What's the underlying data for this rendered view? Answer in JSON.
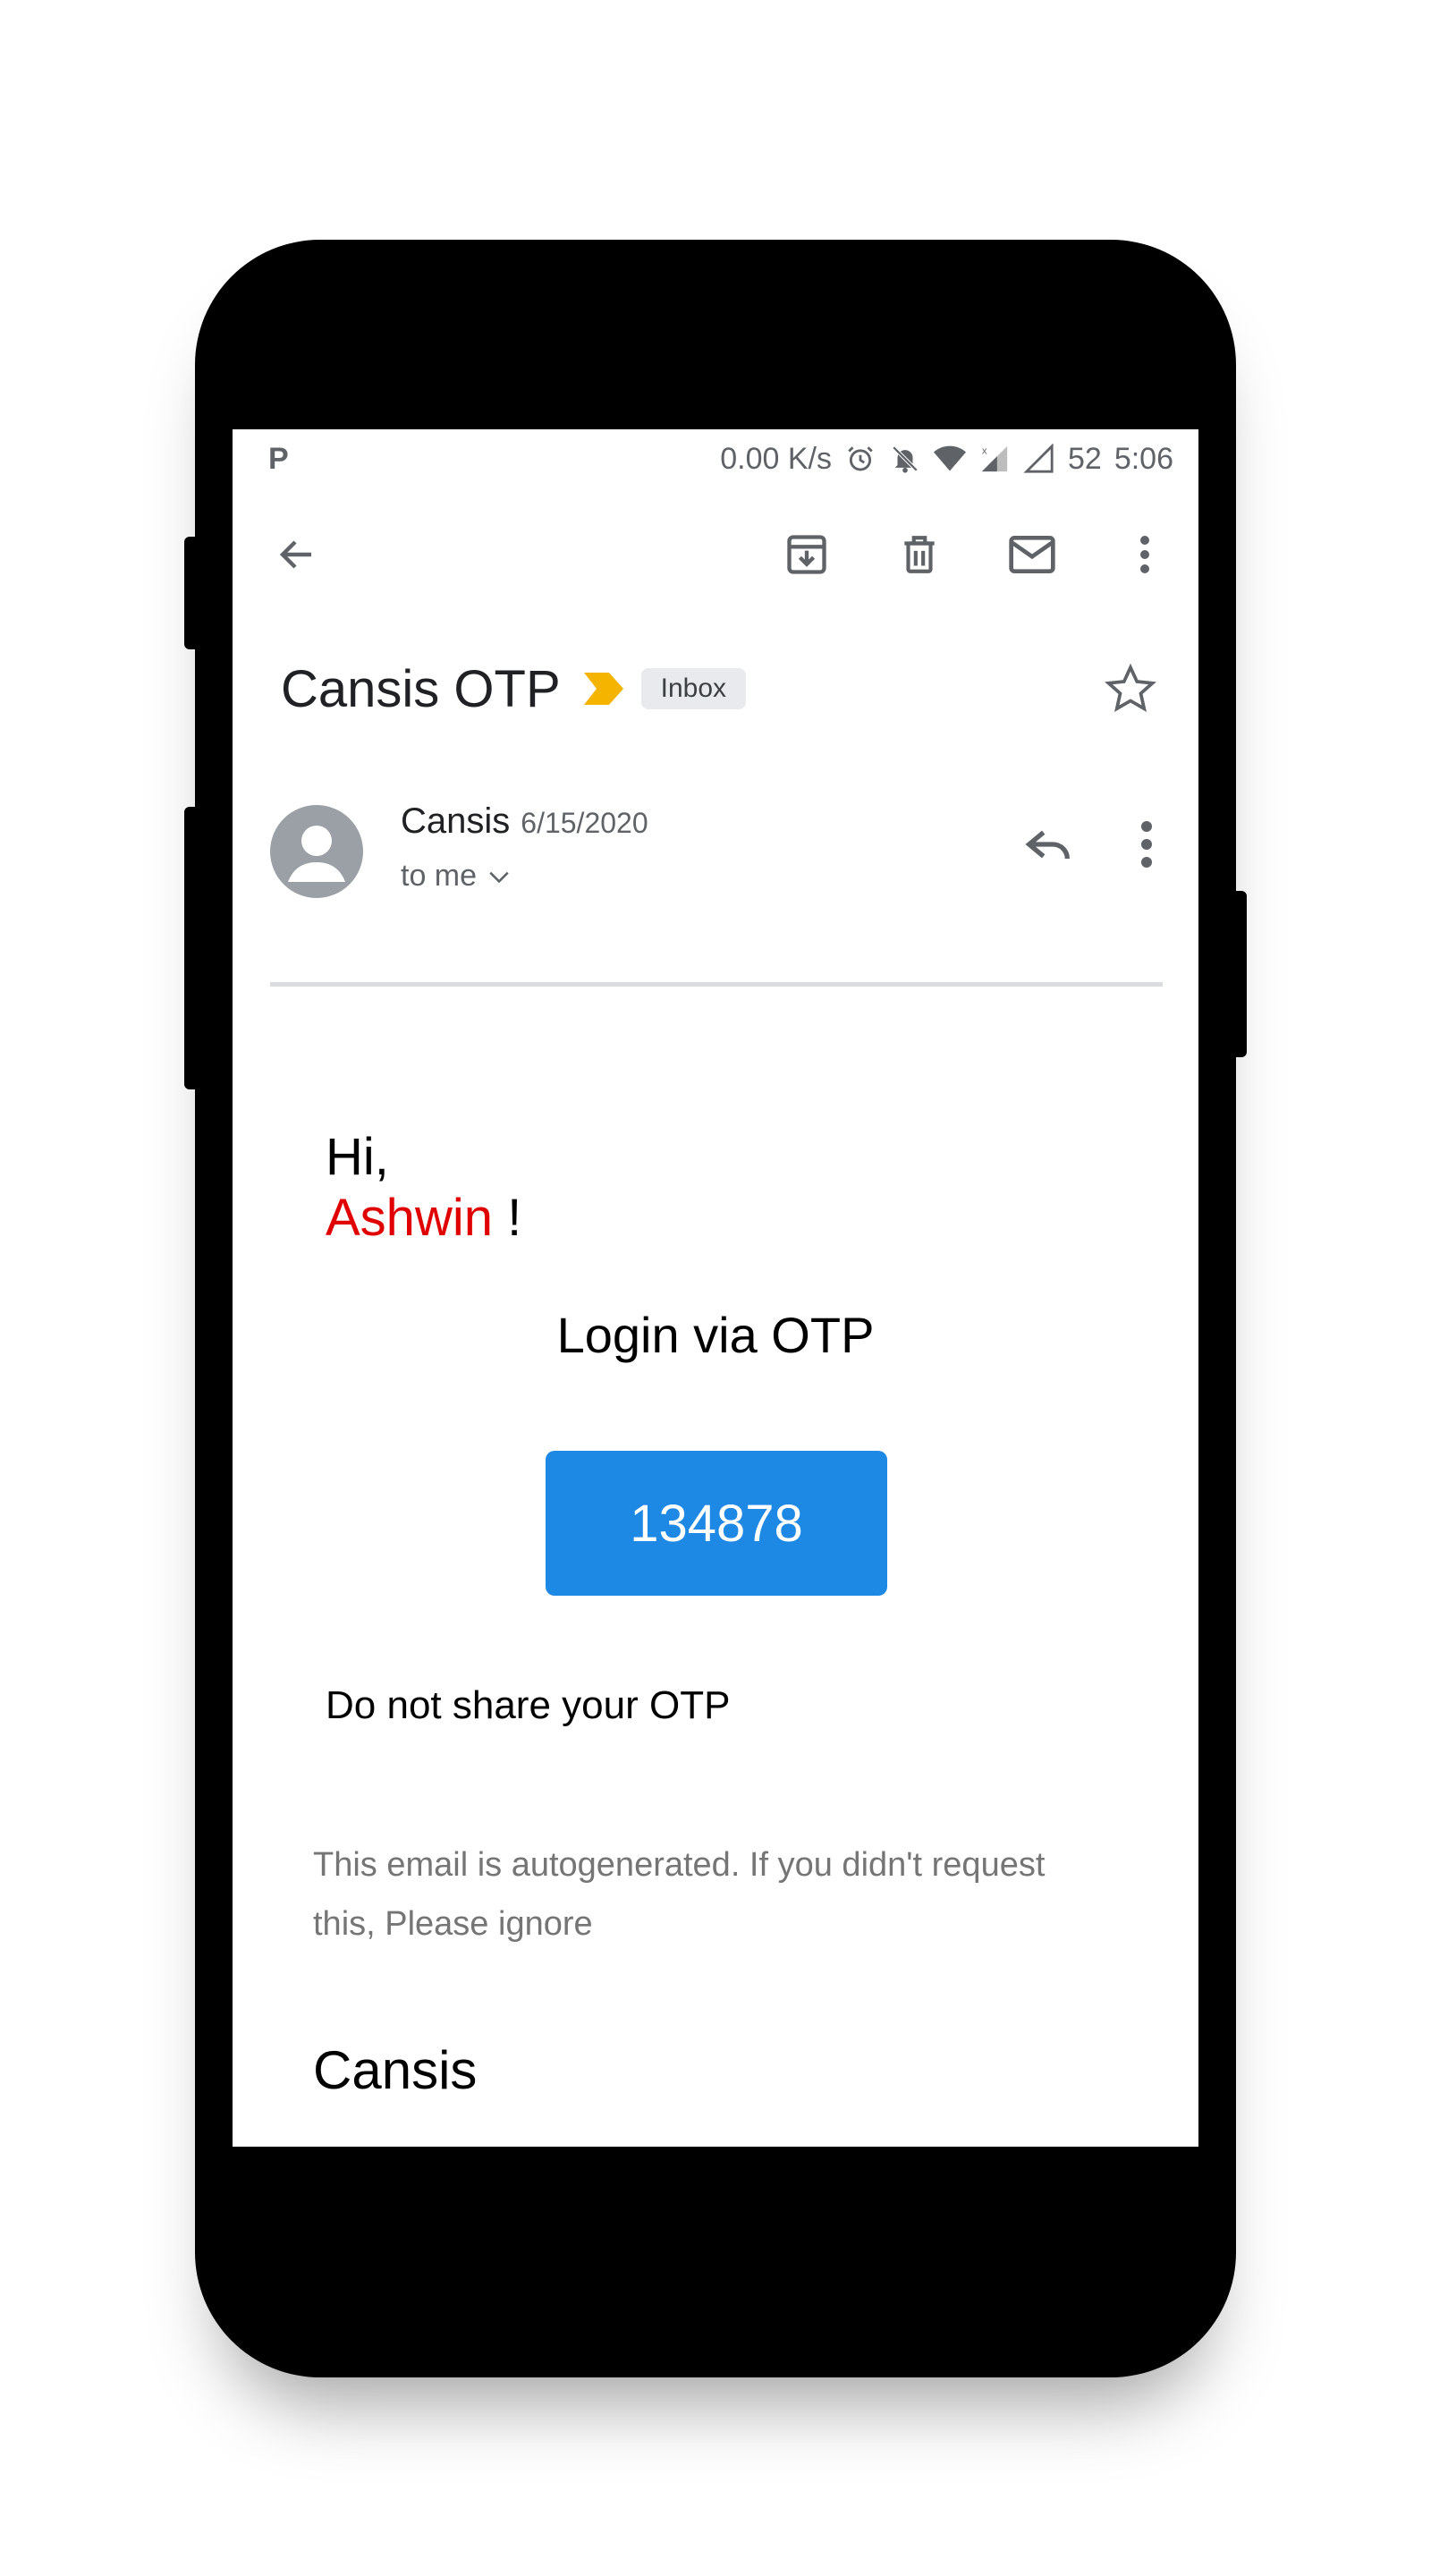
{
  "status_bar": {
    "left_icon": "P",
    "network_speed": "0.00 K/s",
    "battery": "52",
    "time": "5:06",
    "icons": [
      "alarm-icon",
      "bell-off-icon",
      "wifi-icon",
      "signal-icon",
      "signal-empty-icon"
    ]
  },
  "toolbar": {
    "icons": [
      "back-arrow-icon",
      "archive-icon",
      "delete-icon",
      "mark-unread-icon",
      "more-vert-icon"
    ]
  },
  "email": {
    "subject": "Cansis OTP",
    "label": "Inbox",
    "sender": "Cansis",
    "date": "6/15/2020",
    "recipient": "to me",
    "greeting": "Hi,",
    "name": "Ashwin",
    "exclaim": " !",
    "heading": "Login via OTP",
    "otp": "134878",
    "warning": "Do not share your OTP",
    "note": "This email is autogenerated. If you didn't request this, Please ignore",
    "signature": "Cansis"
  },
  "colors": {
    "otp_button": "#1e88e5",
    "name_highlight": "#e00000",
    "important_marker": "#f4b400",
    "divider": "#dadce0"
  }
}
